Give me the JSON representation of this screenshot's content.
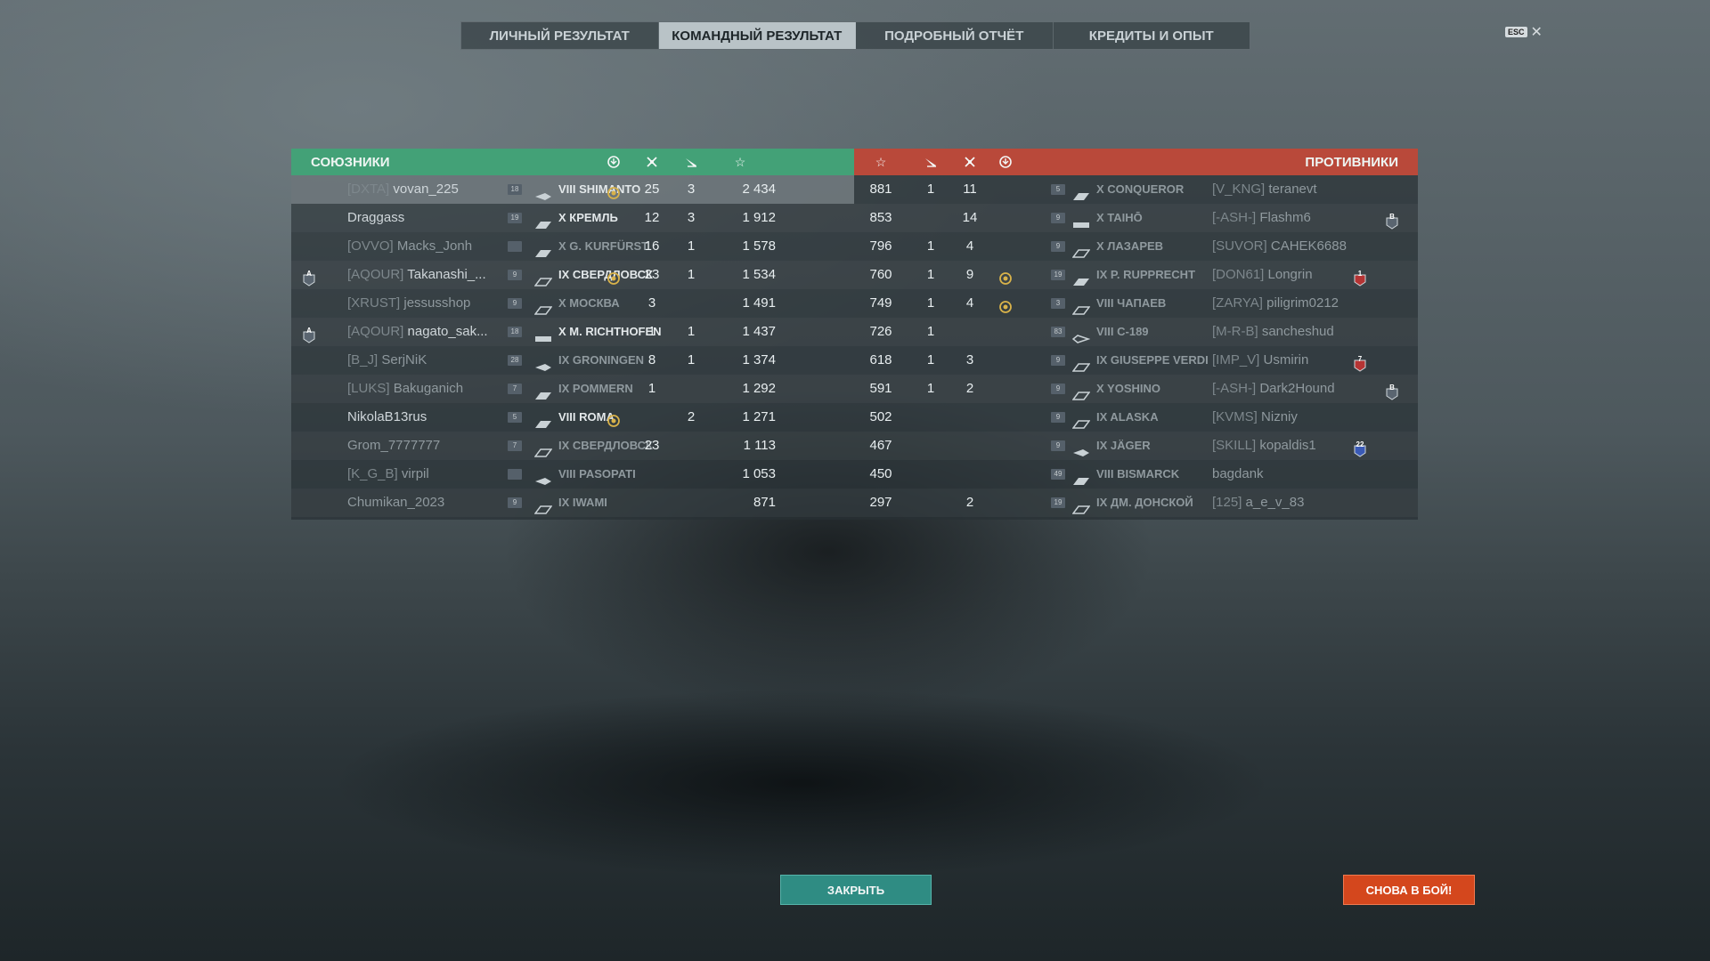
{
  "tabs": [
    {
      "label": "ЛИЧНЫЙ РЕЗУЛЬТАТ",
      "active": false
    },
    {
      "label": "КОМАНДНЫЙ РЕЗУЛЬТАТ",
      "active": true
    },
    {
      "label": "ПОДРОБНЫЙ ОТЧЁТ",
      "active": false
    },
    {
      "label": "КРЕДИТЫ И ОПЫТ",
      "active": false
    }
  ],
  "esc_label": "ESC",
  "allies_title": "СОЮЗНИКИ",
  "enemies_title": "ПРОТИВНИКИ",
  "column_icons": [
    "base-capture-icon",
    "kills-icon",
    "planes-icon",
    "star-xp-icon"
  ],
  "allies": [
    {
      "clan": "[DXTA]",
      "name": "vovan_225",
      "level": "18",
      "ship": "VIII SHIMANTO",
      "ship_class": "destroyer",
      "medal": true,
      "kills": "25",
      "planes": "3",
      "xp": "2 434",
      "highlight": true,
      "dead": false,
      "badge": ""
    },
    {
      "clan": "",
      "name": "Draggass",
      "level": "19",
      "ship": "X КРЕМЛЬ",
      "ship_class": "battleship",
      "medal": false,
      "kills": "12",
      "planes": "3",
      "xp": "1 912",
      "highlight": false,
      "dead": false,
      "badge": ""
    },
    {
      "clan": "[OVVO]",
      "name": "Macks_Jonh",
      "level": "",
      "ship": "X G. KURFÜRST",
      "ship_class": "battleship",
      "medal": false,
      "kills": "16",
      "planes": "1",
      "xp": "1 578",
      "highlight": false,
      "dead": true,
      "badge": ""
    },
    {
      "clan": "[AQOUR]",
      "name": "Takanashi_...",
      "level": "9",
      "ship": "IX СВЕРДЛОВСК",
      "ship_class": "cruiser",
      "medal": true,
      "kills": "23",
      "planes": "1",
      "xp": "1 534",
      "highlight": false,
      "dead": false,
      "badge": "A"
    },
    {
      "clan": "[XRUST]",
      "name": "jessusshop",
      "level": "9",
      "ship": "X МОСКВА",
      "ship_class": "cruiser",
      "medal": false,
      "kills": "3",
      "planes": "",
      "xp": "1 491",
      "highlight": false,
      "dead": true,
      "badge": ""
    },
    {
      "clan": "[AQOUR]",
      "name": "nagato_sak...",
      "level": "18",
      "ship": "X M. RICHTHOFEN",
      "ship_class": "carrier",
      "medal": false,
      "kills": "1",
      "planes": "1",
      "xp": "1 437",
      "highlight": false,
      "dead": false,
      "badge": "A"
    },
    {
      "clan": "[B_J]",
      "name": "SerjNiK",
      "level": "28",
      "ship": "IX GRONINGEN",
      "ship_class": "destroyer",
      "medal": false,
      "kills": "8",
      "planes": "1",
      "xp": "1 374",
      "highlight": false,
      "dead": true,
      "badge": ""
    },
    {
      "clan": "[LUKS]",
      "name": "Bakuganich",
      "level": "7",
      "ship": "IX POMMERN",
      "ship_class": "battleship",
      "medal": false,
      "kills": "1",
      "planes": "",
      "xp": "1 292",
      "highlight": false,
      "dead": true,
      "badge": ""
    },
    {
      "clan": "",
      "name": "NikolaB13rus",
      "level": "5",
      "ship": "VIII ROMA",
      "ship_class": "battleship",
      "medal": true,
      "kills": "",
      "planes": "2",
      "xp": "1 271",
      "highlight": false,
      "dead": false,
      "badge": ""
    },
    {
      "clan": "",
      "name": "Grom_7777777",
      "level": "7",
      "ship": "IX СВЕРДЛОВСК",
      "ship_class": "cruiser",
      "medal": false,
      "kills": "23",
      "planes": "",
      "xp": "1 113",
      "highlight": false,
      "dead": true,
      "badge": ""
    },
    {
      "clan": "[K_G_B]",
      "name": "virpil",
      "level": "",
      "ship": "VIII PASOPATI",
      "ship_class": "destroyer",
      "medal": false,
      "kills": "",
      "planes": "",
      "xp": "1 053",
      "highlight": false,
      "dead": true,
      "badge": ""
    },
    {
      "clan": "",
      "name": "Chumikan_2023",
      "level": "9",
      "ship": "IX IWAMI",
      "ship_class": "cruiser",
      "medal": false,
      "kills": "",
      "planes": "",
      "xp": "871",
      "highlight": false,
      "dead": true,
      "badge": ""
    }
  ],
  "enemies": [
    {
      "clan": "[V_KNG]",
      "name": "teranevt",
      "level": "5",
      "ship": "X CONQUEROR",
      "ship_class": "battleship",
      "medal": false,
      "kills": "11",
      "planes": "1",
      "xp": "881",
      "dead": true,
      "badge": ""
    },
    {
      "clan": "[-ASH-]",
      "name": "Flashm6",
      "level": "9",
      "ship": "X TAIHŌ",
      "ship_class": "carrier",
      "medal": false,
      "kills": "14",
      "planes": "",
      "xp": "853",
      "dead": true,
      "badge": "B"
    },
    {
      "clan": "[SUVOR]",
      "name": "CAHEK6688",
      "level": "9",
      "ship": "X ЛАЗАРЕВ",
      "ship_class": "cruiser",
      "medal": false,
      "kills": "4",
      "planes": "1",
      "xp": "796",
      "dead": true,
      "badge": ""
    },
    {
      "clan": "[DON61]",
      "name": "Longrin",
      "level": "19",
      "ship": "IX P. RUPPRECHT",
      "ship_class": "battleship",
      "medal": true,
      "kills": "9",
      "planes": "1",
      "xp": "760",
      "dead": true,
      "badge": "1"
    },
    {
      "clan": "[ZARYA]",
      "name": "piligrim0212",
      "level": "3",
      "ship": "VIII ЧАПАЕВ",
      "ship_class": "cruiser",
      "medal": true,
      "kills": "4",
      "planes": "1",
      "xp": "749",
      "dead": true,
      "badge": ""
    },
    {
      "clan": "[M-R-B]",
      "name": "sancheshud",
      "level": "83",
      "ship": "VIII C-189",
      "ship_class": "submarine",
      "medal": false,
      "kills": "",
      "planes": "1",
      "xp": "726",
      "dead": true,
      "badge": ""
    },
    {
      "clan": "[IMP_V]",
      "name": "Usmirin",
      "level": "9",
      "ship": "IX GIUSEPPE VERDI",
      "ship_class": "cruiser",
      "medal": false,
      "kills": "3",
      "planes": "1",
      "xp": "618",
      "dead": true,
      "badge": "7"
    },
    {
      "clan": "[-ASH-]",
      "name": "Dark2Hound",
      "level": "9",
      "ship": "X YOSHINO",
      "ship_class": "cruiser",
      "medal": false,
      "kills": "2",
      "planes": "1",
      "xp": "591",
      "dead": true,
      "badge": "B"
    },
    {
      "clan": "[KVMS]",
      "name": "Nizniy",
      "level": "9",
      "ship": "IX ALASKA",
      "ship_class": "cruiser",
      "medal": false,
      "kills": "",
      "planes": "",
      "xp": "502",
      "dead": true,
      "badge": ""
    },
    {
      "clan": "[SKILL]",
      "name": "kopaldis1",
      "level": "9",
      "ship": "IX JÄGER",
      "ship_class": "destroyer",
      "medal": false,
      "kills": "",
      "planes": "",
      "xp": "467",
      "dead": true,
      "badge": "22"
    },
    {
      "clan": "",
      "name": "bagdank",
      "level": "49",
      "ship": "VIII BISMARCK",
      "ship_class": "battleship",
      "medal": false,
      "kills": "",
      "planes": "",
      "xp": "450",
      "dead": true,
      "badge": ""
    },
    {
      "clan": "[125]",
      "name": "a_e_v_83",
      "level": "19",
      "ship": "IX ДМ. ДОНСКОЙ",
      "ship_class": "cruiser",
      "medal": false,
      "kills": "2",
      "planes": "",
      "xp": "297",
      "dead": true,
      "badge": ""
    }
  ],
  "buttons": {
    "close": "ЗАКРЫТЬ",
    "again": "СНОВА В БОЙ!"
  },
  "colors": {
    "allies": "#43a177",
    "enemies": "#b9493a",
    "close_btn": "#2f8c83",
    "again_btn": "#d4471d",
    "medal": "#d8b24a"
  }
}
